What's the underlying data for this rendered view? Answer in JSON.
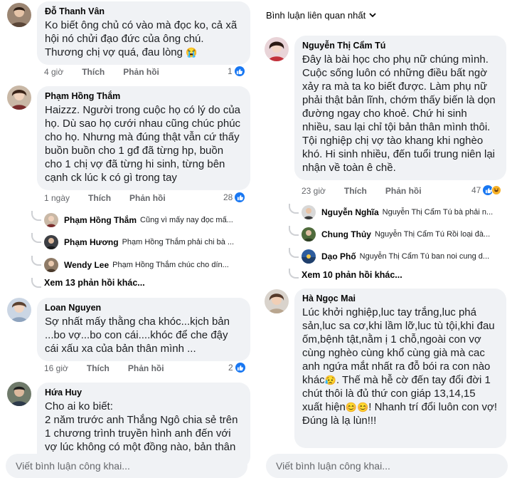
{
  "left": {
    "comments": [
      {
        "author": "Đỗ Thanh Vân",
        "text": "Ko biết ông chủ có vào mà đọc ko, cả xã hội nó chửi đạo đức của ông chú. Thương chị vợ quá, đau lòng",
        "emoji": "😭",
        "time": "4 giờ",
        "like": "Thích",
        "reply": "Phản hồi",
        "reactions": "1"
      },
      {
        "author": "Phạm Hồng Thắm",
        "text": "Haizzz. Người trong cuộc họ có lý do của họ. Dù sao họ cưới nhau cũng chúc phúc cho họ. Nhưng mà đúng thật vẫn cứ thấy buồn buồn cho 1 gđ đã từng hp, buồn cho 1 chị vợ đã từng hi sinh, từng bên cạnh ck lúc k có gì trong tay",
        "time": "1 ngày",
        "like": "Thích",
        "reply": "Phản hồi",
        "reactions": "28"
      },
      {
        "author": "Loan Nguyen",
        "text": "Sợ nhất mấy thằng cha khóc...kịch bản ...bo vợ...bo con cái....khóc để che đậy cái xấu xa của bản thân mình ...",
        "time": "16 giờ",
        "like": "Thích",
        "reply": "Phản hồi",
        "reactions": "2"
      },
      {
        "author": "Hứa Huy",
        "text": "Cho ai ko biết:\n2 năm trước anh Thắng Ngô chia sẻ trên 1 chương trình truyền hình anh đến với vợ lúc không có một đồng nào, bản thân"
      }
    ],
    "replies": [
      {
        "name": "Phạm Hồng Thắm",
        "text": "Cũng vì mấy nay đọc mấ..."
      },
      {
        "name": "Phạm Hương",
        "text": "Phạm Hồng Thắm phải chi bà ..."
      },
      {
        "name": "Wendy Lee",
        "text": "Phạm Hồng Thắm chúc cho dín..."
      }
    ],
    "more_replies": "Xem 13 phản hồi khác...",
    "footer_placeholder": "Viết bình luận công khai..."
  },
  "right": {
    "sort_label": "Bình luận liên quan nhất",
    "comments": [
      {
        "author": "Nguyễn Thị Cẩm Tú",
        "text": "Đây là bài học cho phụ nữ chúng mình. Cuộc sống luôn có những điều bất ngờ xảy ra mà ta ko biết được. Làm phụ nữ phải thật bản lĩnh, chớm thấy biến là dọn đường ngay cho khoẻ. Chứ hi sinh nhiều, sau lại chỉ tội bản thân mình thôi. Tội nghiệp chị vợ tào khang khi nghèo khó. Hi sinh nhiều, đến tuổi trung niên lại nhận về toàn ê chề.",
        "time": "23 giờ",
        "like": "Thích",
        "reply": "Phản hồi",
        "reactions": "47"
      },
      {
        "author": "Hà Ngọc Mai",
        "text_1": "Lúc khởi nghiệp,luc tay trắng,luc phá sản,luc sa cơ,khi lầm lỡ,luc tù tội,khi đau ốm,bệnh tật,nằm ị 1 chỗ,ngoài con vợ cùng nghèo cùng khổ cùng già mà cac anh ngứa mắt nhất ra đỗ bói ra con nào khác",
        "text_2": ". Thế mà hễ cờ đến tay đổi đời 1 chút thôi là đủ thứ con giáp 13,14,15 xuất hiện",
        "text_3": "! Nhanh trí đổi luôn con vợ!",
        "text_4": "Đúng là lạ lùn!!!",
        "emoji": "😥",
        "emoji_pair": "😊😊"
      }
    ],
    "replies": [
      {
        "name": "Nguyễn Nghĩa",
        "text": "Nguyễn Thị Cẩm Tú bà phải n..."
      },
      {
        "name": "Chung Thủy",
        "text": "Nguyễn Thị Cẩm Tú Rồi loại đà..."
      },
      {
        "name": "Dạo Phố",
        "text": "Nguyễn Thị Cẩm Tú ban noi cung d..."
      }
    ],
    "more_replies": "Xem 10 phản hồi khác...",
    "footer_placeholder": "Viết bình luận công khai..."
  },
  "colors": {
    "bubble": "#f0f2f5",
    "like": "#1877f2",
    "muted": "#65676b"
  },
  "icons": [
    "like-reaction-icon",
    "haha-reaction-icon",
    "chevron-down-icon"
  ]
}
